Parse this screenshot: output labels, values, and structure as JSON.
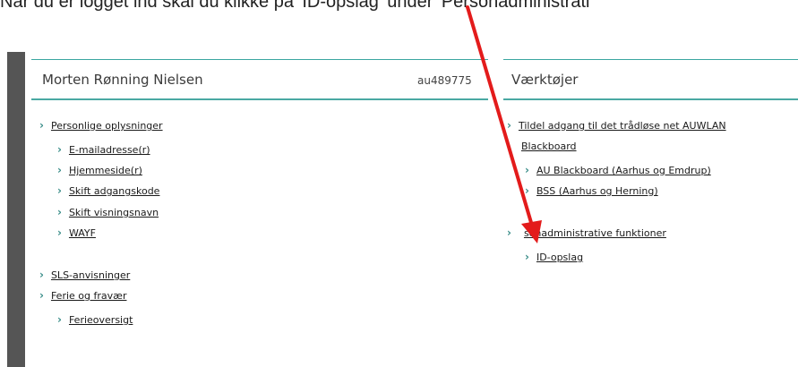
{
  "instruction": "Når du er logget ind skal du klikke på 'ID-opslag' under 'Personadministrati",
  "profile": {
    "name": "Morten Rønning Nielsen",
    "user_id": "au489775",
    "items": [
      {
        "label": "Personlige oplysninger"
      },
      {
        "label": "E-mailadresse(r)"
      },
      {
        "label": "Hjemmeside(r)"
      },
      {
        "label": "Skift adgangskode"
      },
      {
        "label": "Skift visningsnavn"
      },
      {
        "label": "WAYF"
      },
      {
        "label": "SLS-anvisninger"
      },
      {
        "label": "Ferie og fravær"
      },
      {
        "label": "Ferieoversigt"
      }
    ]
  },
  "tools": {
    "title": "Værktøjer",
    "items": [
      {
        "label": "Tildel adgang til det trådløse net AUWLAN"
      },
      {
        "label": "Blackboard"
      },
      {
        "label": "AU Blackboard (Aarhus og Emdrup)"
      },
      {
        "label": "BSS (Aarhus og Herning)"
      },
      {
        "label": "sonadministrative funktioner"
      },
      {
        "label": "ID-opslag"
      }
    ]
  },
  "annotation": {
    "arrow_color": "#e31b1b"
  },
  "colors": {
    "accent": "#3aa6a0",
    "sidebar": "#555555"
  }
}
